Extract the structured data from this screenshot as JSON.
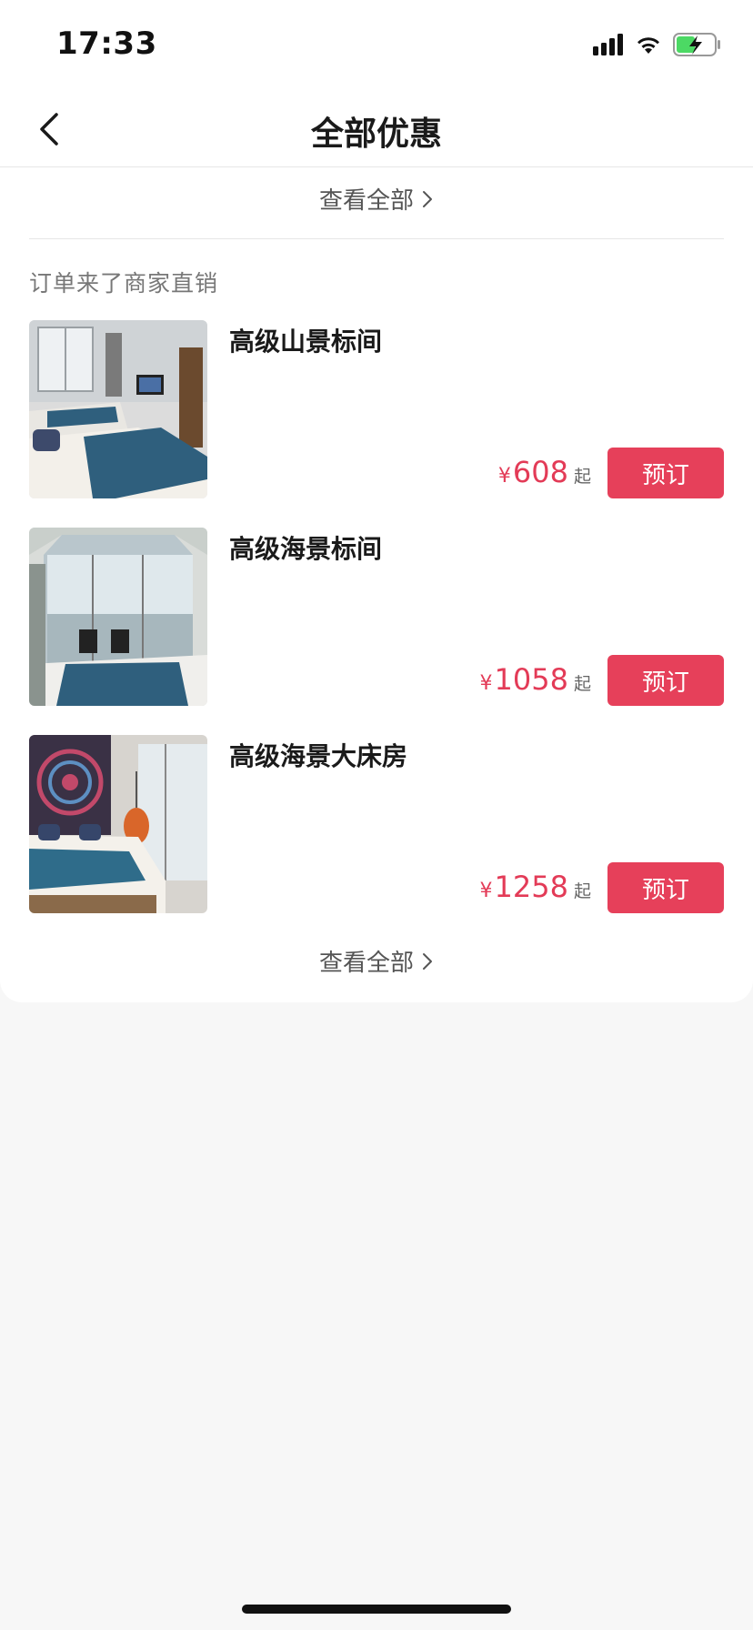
{
  "status_bar": {
    "time": "17:33",
    "icons": [
      "cellular-signal-icon",
      "wifi-icon",
      "battery-charging-icon"
    ]
  },
  "nav": {
    "back_icon": "chevron-left-icon",
    "title": "全部优惠"
  },
  "top_view_all": {
    "label": "查看全部",
    "icon": "chevron-right-icon"
  },
  "section": {
    "title": "订单来了商家直销",
    "rooms": [
      {
        "name": "高级山景标间",
        "currency": "¥",
        "price": "608",
        "suffix": "起",
        "button": "预订",
        "image": "room-mountain-view-twin"
      },
      {
        "name": "高级海景标间",
        "currency": "¥",
        "price": "1058",
        "suffix": "起",
        "button": "预订",
        "image": "room-sea-view-twin"
      },
      {
        "name": "高级海景大床房",
        "currency": "¥",
        "price": "1258",
        "suffix": "起",
        "button": "预订",
        "image": "room-sea-view-king"
      }
    ],
    "view_all": {
      "label": "查看全部",
      "icon": "chevron-right-icon"
    }
  },
  "colors": {
    "accent": "#e6405a",
    "price": "#e33b57",
    "background": "#f7f7f7",
    "card": "#ffffff"
  }
}
